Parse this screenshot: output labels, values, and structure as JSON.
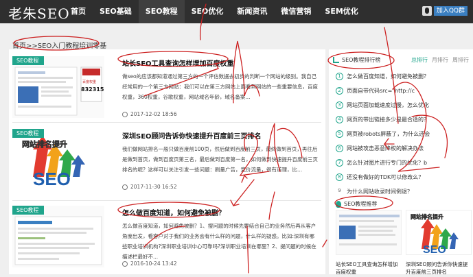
{
  "header": {
    "logo": "老朱SEO",
    "nav": [
      "首页",
      "SEO基础",
      "SEO教程",
      "SEO优化",
      "新闻资讯",
      "微信营销",
      "SEM优化"
    ],
    "active_index": 2,
    "qq_button": "加入QQ群"
  },
  "breadcrumb": "首页>>SEO入门教程培训零基",
  "posts": [
    {
      "tag": "SEO教程",
      "title": "站长SEO工具查询怎样增加百度权重",
      "desc": "做seo的应该都知道通过第三方的一个评估数据去初步的判断一个网站的级别。我自己经常用的一个第三方网站：我们可以在第三方网站上面看到网站的一些重要信息，百度权重，360权重，谷歌权重，网站域名年龄，域名备案...",
      "date": "2017-12-02 18:56",
      "thumb_text": "",
      "thumb_badge": "8323155",
      "thumb_badge_top": "百度权重"
    },
    {
      "tag": "SEO教程",
      "title": "深圳SEO顾问告诉你快速提升百度前三页排名",
      "desc": "我们做网站排名一般只做百度前100页，然后做到百度前三页，最终做到首页，再往后是做到首页，做到百度页第三名，最后做到百度第一名，如何做到快速提升百度前三页排名的呢？这样可以关注引发一些问题：刷量广告，竞价流量，很有道理，比...",
      "date": "2017-11-30 16:52",
      "thumb_text": "网站排名提升",
      "thumb_seo": "SEO"
    },
    {
      "tag": "SEO教程",
      "title": "怎么做百度知道，如何避免被删？",
      "desc": "怎么做百度知道，如何避免被删？1、搜问题的时候先要结合自己的业务然后再从客户角度出发，看客户对于我们的业务会有什么样的问题，什么样的疑惑。比如:深圳有哪些职业培训机构?深圳职业培训中心可靠吗?深圳职业培训在哪里？2、提问题的时候在描述栏最好不...",
      "date": "2016-10-24 13:42",
      "thumb_text": "",
      "thumb_seo": ""
    }
  ],
  "sidebar": {
    "title": "SEO教程排行榜",
    "tabs": [
      "总排行",
      "月排行",
      "周排行"
    ],
    "ranks": [
      "怎么做百度知道，如何避免被删？",
      "页面自带代码src=\"http://c",
      "网站页面加载速度过慢，怎么优化",
      "网页的带出链接多少是最合适的？",
      "网页被robots屏蔽了，为什么还会",
      "网站被攻击恶意降权的解决办法",
      "怎么针对图片进行专门的优化？b",
      "还没有做好的TDK可以修改么？",
      "为什么网站收录时间倒退？"
    ],
    "rank_numbers": [
      "1",
      "2",
      "3",
      "4",
      "5",
      "6",
      "7",
      "8",
      "9"
    ],
    "recommend_title": "SEO教程推荐",
    "recommends": [
      {
        "caption": "站长SEO工具查询怎样增加百度权重",
        "img_text": ""
      },
      {
        "caption": "深圳SEO顾问告诉你快速提升百度前三页排名",
        "img_text": "网站排名提升"
      }
    ]
  },
  "colors": {
    "accent": "#20a58c",
    "topbar": "#2f2f2f",
    "annotation": "#cc2020"
  }
}
